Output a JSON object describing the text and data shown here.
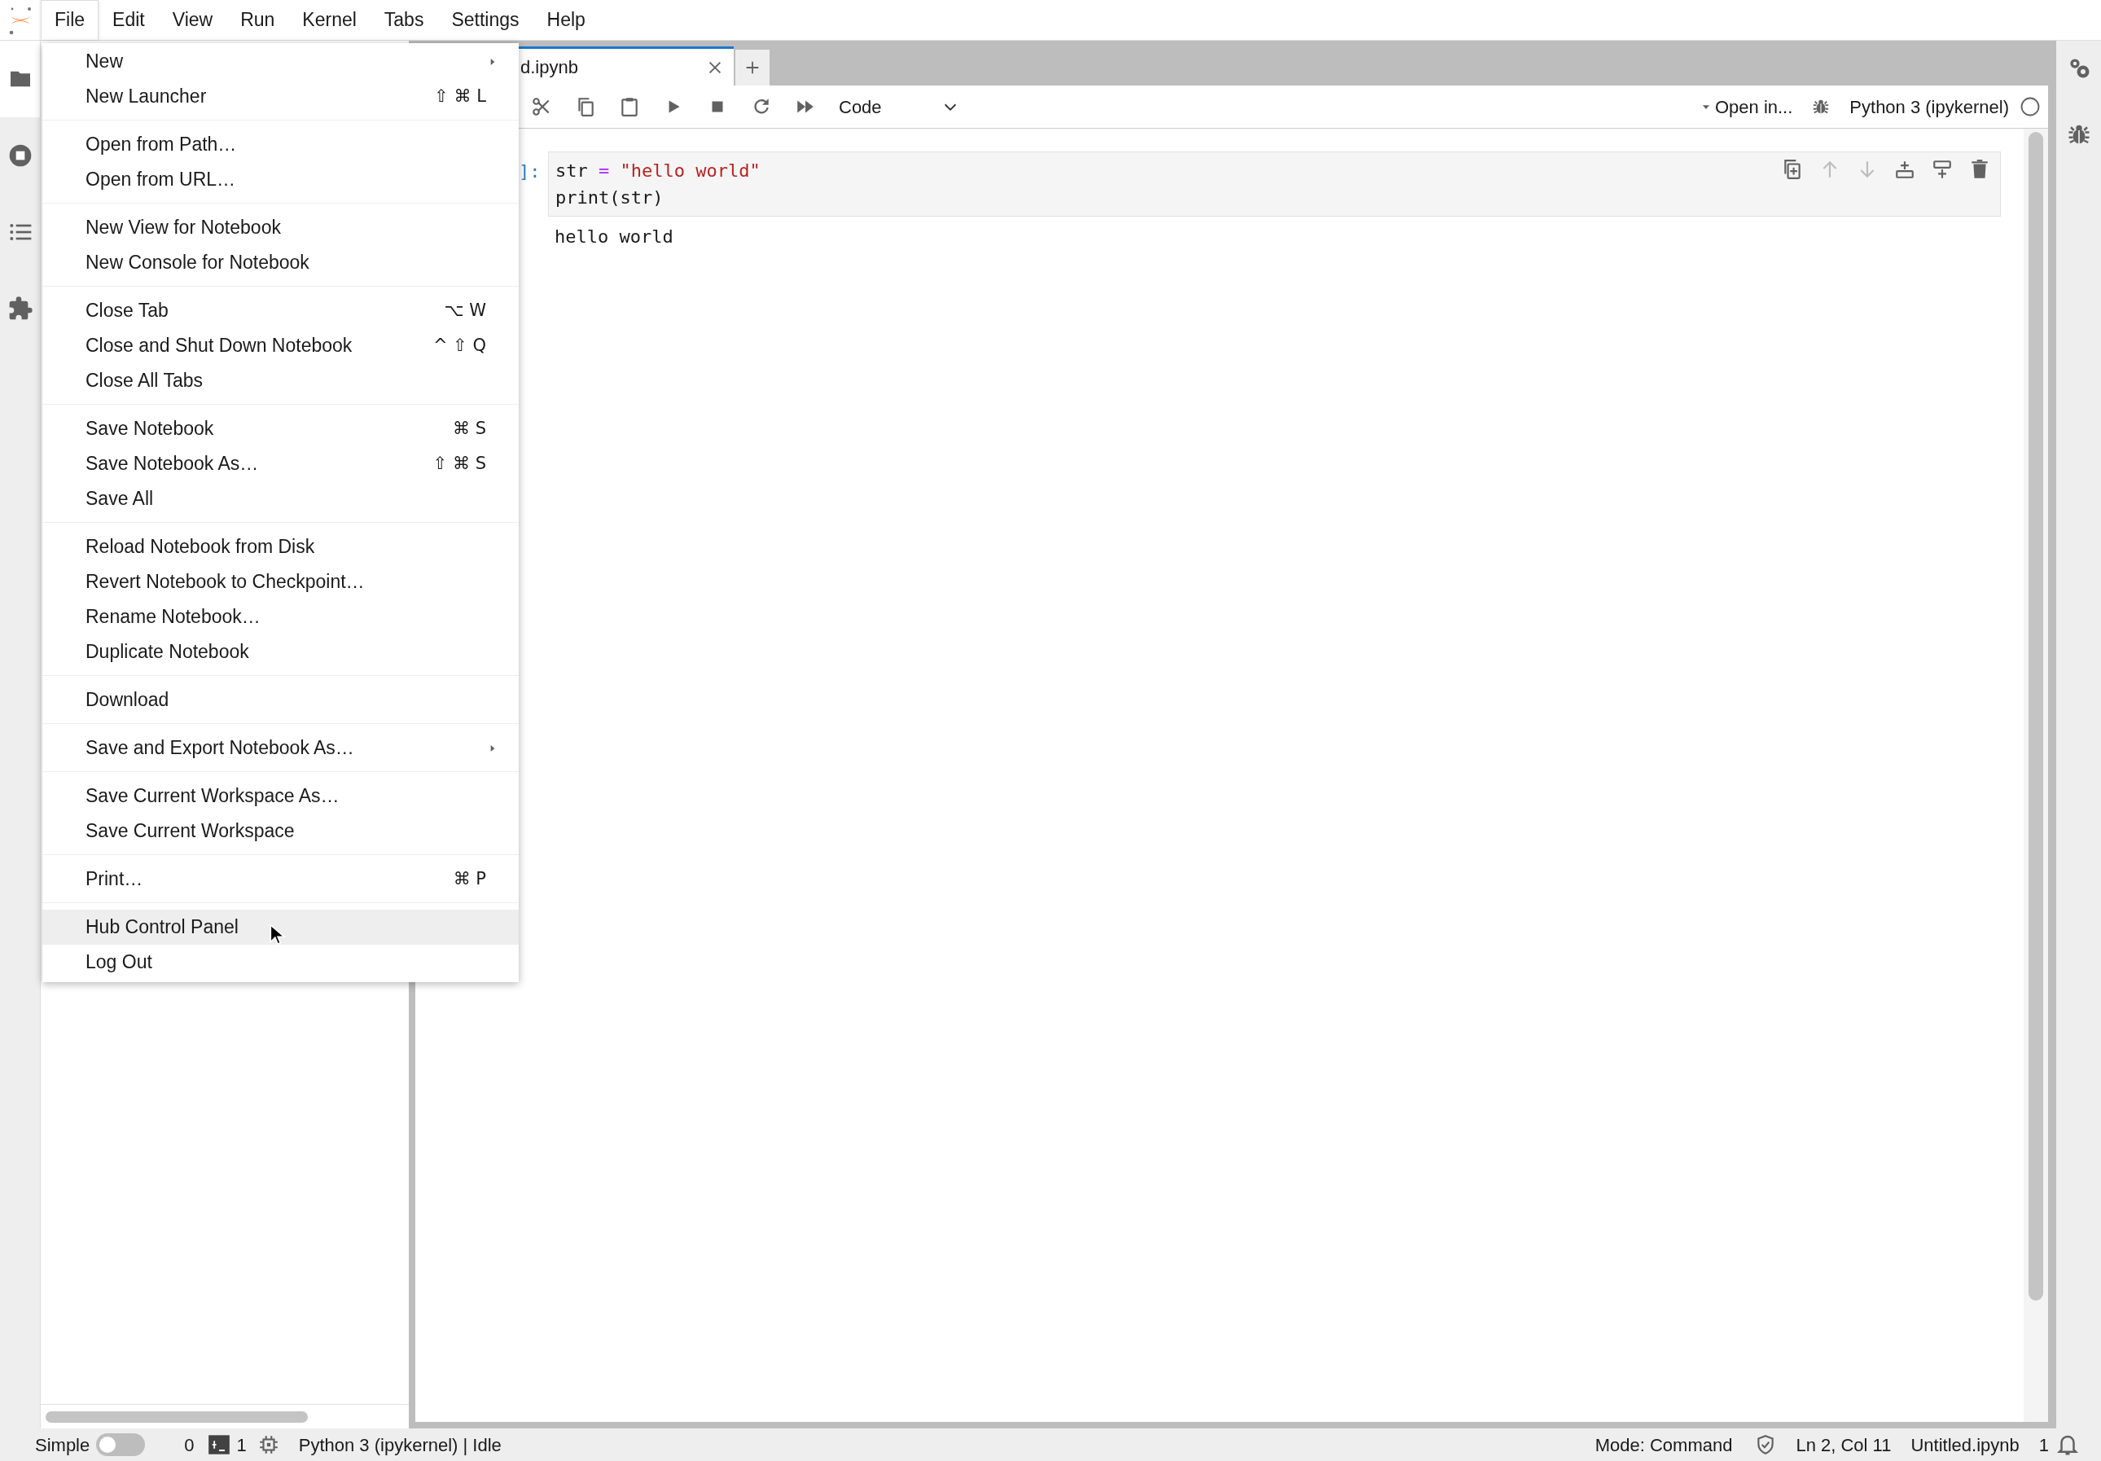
{
  "menubar": {
    "items": [
      {
        "label": "File",
        "selected": true
      },
      {
        "label": "Edit",
        "selected": false
      },
      {
        "label": "View",
        "selected": false
      },
      {
        "label": "Run",
        "selected": false
      },
      {
        "label": "Kernel",
        "selected": false
      },
      {
        "label": "Tabs",
        "selected": false
      },
      {
        "label": "Settings",
        "selected": false
      },
      {
        "label": "Help",
        "selected": false
      }
    ]
  },
  "activity_bar": {
    "items": [
      {
        "selected": true
      },
      {
        "selected": false
      },
      {
        "selected": false
      },
      {
        "selected": false
      }
    ]
  },
  "tab_bar": {
    "tabs": [
      {
        "label": "d.ipynb",
        "selected": true
      }
    ]
  },
  "toolbar": {
    "cell_type": "Code",
    "open_in": "Open in...",
    "kernel": "Python 3 (ipykernel)",
    "kernel_busy": false
  },
  "notebook": {
    "cells": [
      {
        "prompt": "]:",
        "code": [
          [
            {
              "text": "str ",
              "kind": "plain"
            },
            {
              "text": "= ",
              "kind": "operator"
            },
            {
              "text": "\"hello world\"",
              "kind": "string"
            }
          ],
          [
            {
              "text": "print(str)",
              "kind": "plain"
            }
          ]
        ],
        "output": "hello world",
        "actions": [
          {
            "disabled": false
          },
          {
            "disabled": true
          },
          {
            "disabled": true
          },
          {
            "disabled": false
          },
          {
            "disabled": false
          },
          {
            "disabled": false
          }
        ]
      }
    ]
  },
  "file_menu": {
    "groups": [
      [
        {
          "label": "New",
          "submenu": true,
          "highlighted": false
        },
        {
          "label": "New Launcher",
          "shortcut": "⇧ ⌘ L",
          "submenu": false,
          "highlighted": false
        }
      ],
      [
        {
          "label": "Open from Path…",
          "submenu": false,
          "highlighted": false
        },
        {
          "label": "Open from URL…",
          "submenu": false,
          "highlighted": false
        }
      ],
      [
        {
          "label": "New View for Notebook",
          "submenu": false,
          "highlighted": false
        },
        {
          "label": "New Console for Notebook",
          "submenu": false,
          "highlighted": false
        }
      ],
      [
        {
          "label": "Close Tab",
          "shortcut": "⌥ W",
          "submenu": false,
          "highlighted": false
        },
        {
          "label": "Close and Shut Down Notebook",
          "shortcut": "^ ⇧ Q",
          "submenu": false,
          "highlighted": false
        },
        {
          "label": "Close All Tabs",
          "submenu": false,
          "highlighted": false
        }
      ],
      [
        {
          "label": "Save Notebook",
          "shortcut": "⌘ S",
          "submenu": false,
          "highlighted": false
        },
        {
          "label": "Save Notebook As…",
          "shortcut": "⇧ ⌘ S",
          "submenu": false,
          "highlighted": false
        },
        {
          "label": "Save All",
          "submenu": false,
          "highlighted": false
        }
      ],
      [
        {
          "label": "Reload Notebook from Disk",
          "submenu": false,
          "highlighted": false
        },
        {
          "label": "Revert Notebook to Checkpoint…",
          "submenu": false,
          "highlighted": false
        },
        {
          "label": "Rename Notebook…",
          "submenu": false,
          "highlighted": false
        },
        {
          "label": "Duplicate Notebook",
          "submenu": false,
          "highlighted": false
        }
      ],
      [
        {
          "label": "Download",
          "submenu": false,
          "highlighted": false
        }
      ],
      [
        {
          "label": "Save and Export Notebook As…",
          "submenu": true,
          "highlighted": false
        }
      ],
      [
        {
          "label": "Save Current Workspace As…",
          "submenu": false,
          "highlighted": false
        },
        {
          "label": "Save Current Workspace",
          "submenu": false,
          "highlighted": false
        }
      ],
      [
        {
          "label": "Print…",
          "shortcut": "⌘ P",
          "submenu": false,
          "highlighted": false
        }
      ],
      [
        {
          "label": "Hub Control Panel",
          "submenu": false,
          "highlighted": true
        },
        {
          "label": "Log Out",
          "submenu": false,
          "highlighted": false
        }
      ]
    ]
  },
  "status_bar": {
    "mode_label": "Simple",
    "simple_mode_on": false,
    "terminals": "0",
    "kernels": "1",
    "kernel_status": "Python 3 (ipykernel) | Idle",
    "mode": "Mode: Command",
    "position": "Ln 2, Col 11",
    "file": "Untitled.ipynb",
    "notifications": "1"
  }
}
